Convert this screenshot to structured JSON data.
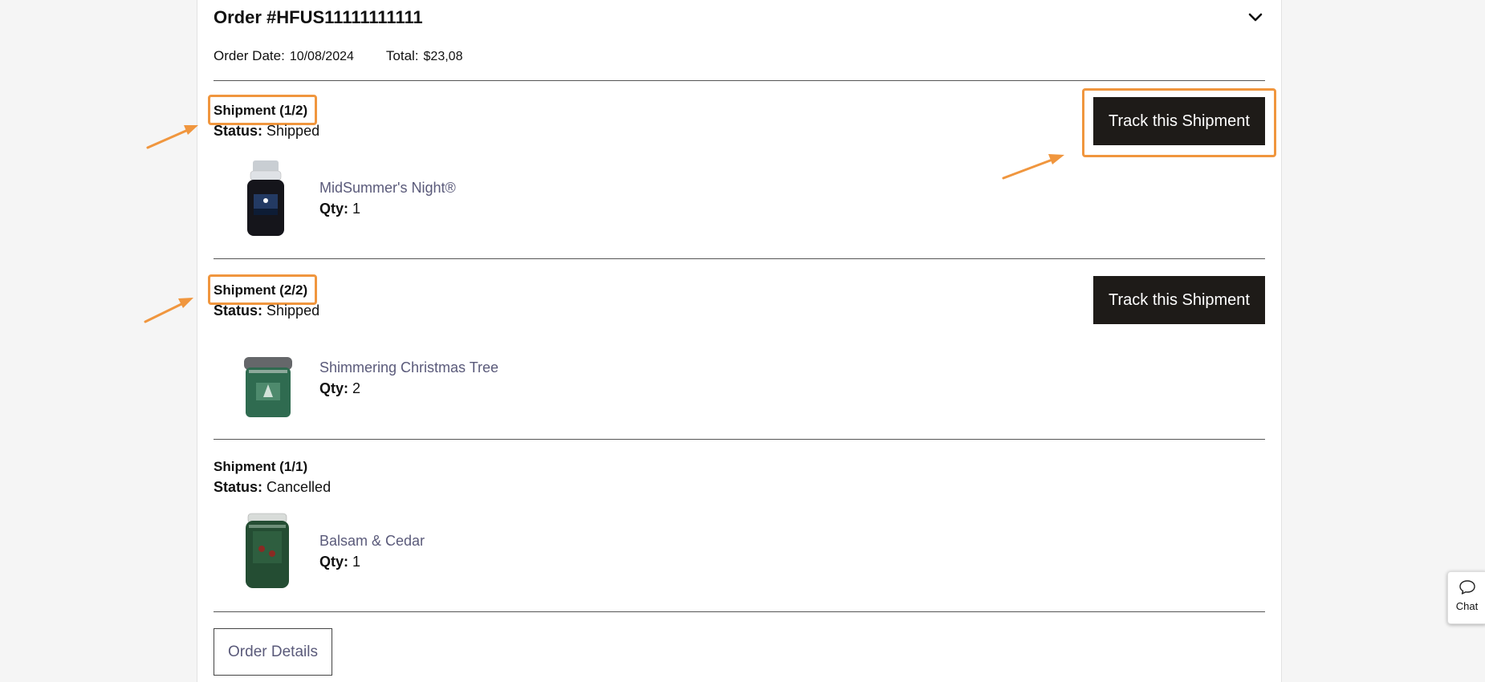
{
  "order": {
    "title": "Order #HFUS11111111111",
    "date_label": "Order Date:",
    "date_value": "10/08/2024",
    "total_label": "Total:",
    "total_value": "$23,08"
  },
  "shipments": [
    {
      "heading": "Shipment (1/2)",
      "status_label": "Status:",
      "status_value": "Shipped",
      "track_label": "Track this Shipment",
      "product": {
        "name": "MidSummer's Night®",
        "qty_label": "Qty:",
        "qty_value": "1"
      }
    },
    {
      "heading": "Shipment (2/2)",
      "status_label": "Status:",
      "status_value": "Shipped",
      "track_label": "Track this Shipment",
      "product": {
        "name": "Shimmering Christmas Tree",
        "qty_label": "Qty:",
        "qty_value": "2"
      }
    },
    {
      "heading": "Shipment (1/1)",
      "status_label": "Status:",
      "status_value": "Cancelled",
      "product": {
        "name": "Balsam & Cedar",
        "qty_label": "Qty:",
        "qty_value": "1"
      }
    }
  ],
  "order_details_label": "Order Details",
  "chat_label": "Chat",
  "icons": {
    "collapse": "chevron-down-icon",
    "chat": "chat-bubble-icon",
    "annotation": "arrow-icon"
  },
  "colors": {
    "highlight": "#f0963e",
    "button_bg": "#1e1b18",
    "link": "#5a5a7a"
  }
}
